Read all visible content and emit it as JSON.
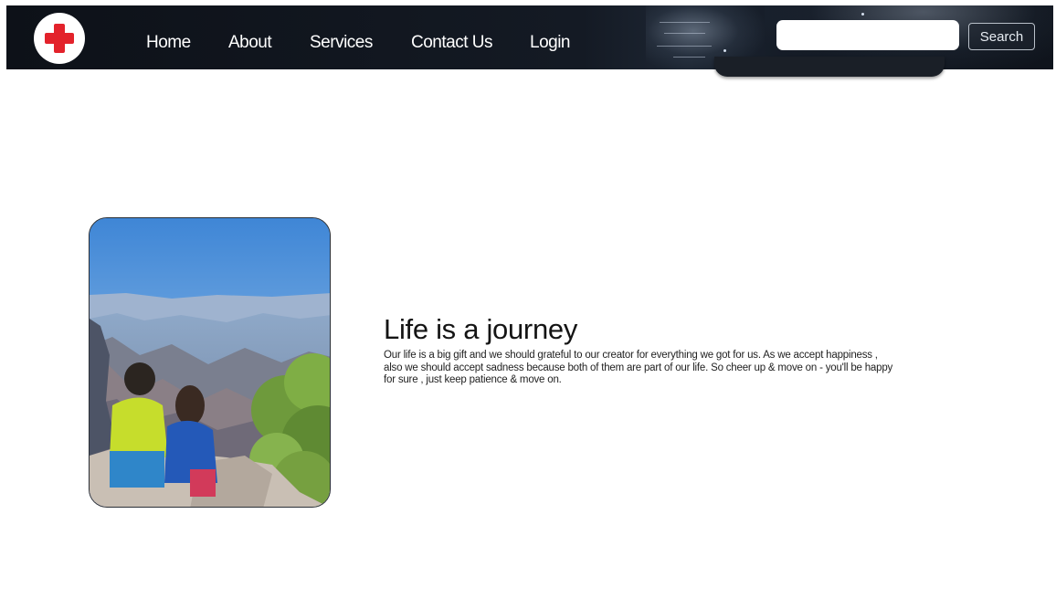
{
  "navbar": {
    "logo_icon": "red-cross-icon",
    "links": [
      {
        "label": "Home"
      },
      {
        "label": "About"
      },
      {
        "label": "Services"
      },
      {
        "label": "Contact Us"
      },
      {
        "label": "Login"
      }
    ],
    "search": {
      "value": "",
      "placeholder": "",
      "button_label": "Search"
    }
  },
  "hero": {
    "image_icon": "landscape-photo",
    "title": "Life is a journey",
    "text": "Our life is a big gift and we should grateful to our creator for everything we got for us. As we accept happiness , also we should accept sadness because both of them are part of our life. So cheer up & move on - you'll be happy for sure , just keep patience & move on."
  },
  "colors": {
    "navbar_bg": "#141a24",
    "accent_red": "#e3222b",
    "text_dark": "#141414"
  }
}
